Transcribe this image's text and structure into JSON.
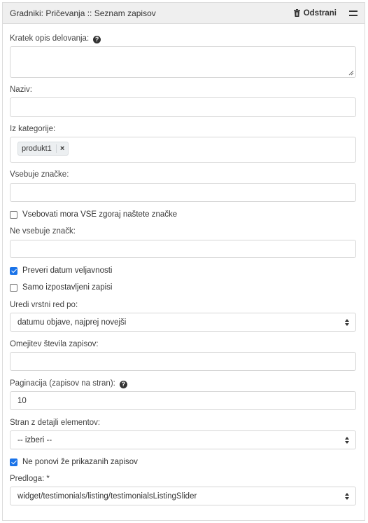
{
  "header": {
    "title": "Gradniki: Pričevanja :: Seznam zapisov",
    "remove_label": "Odstrani",
    "remove_icon": "trash-icon",
    "menu_icon": "hamburger-menu-icon"
  },
  "fields": {
    "short_description": {
      "label": "Kratek opis delovanja:",
      "value": ""
    },
    "name": {
      "label": "Naziv:",
      "value": ""
    },
    "from_category": {
      "label": "Iz kategorije:",
      "tags": [
        "produkt1"
      ],
      "remove_symbol": "×"
    },
    "contains_tags": {
      "label": "Vsebuje značke:",
      "value": ""
    },
    "must_contain_all": {
      "label": "Vsebovati mora VSE zgoraj naštete značke",
      "checked": false
    },
    "not_contains_tags": {
      "label": "Ne vsebuje značk:",
      "value": ""
    },
    "check_validity": {
      "label": "Preveri datum veljavnosti",
      "checked": true
    },
    "featured_only": {
      "label": "Samo izpostavljeni zapisi",
      "checked": false
    },
    "order_by": {
      "label": "Uredi vrstni red po:",
      "value": "datumu objave, najprej novejši"
    },
    "limit": {
      "label": "Omejitev števila zapisov:",
      "value": ""
    },
    "pagination": {
      "label": "Paginacija (zapisov na stran):",
      "value": "10"
    },
    "detail_page": {
      "label": "Stran z detajli elementov:",
      "value": "-- izberi --"
    },
    "no_repeat": {
      "label": "Ne ponovi že prikazanih zapisov",
      "checked": true
    },
    "template": {
      "label": "Predloga: *",
      "value": "widget/testimonials/listing/testimonialsListingSlider"
    }
  },
  "help_icon_glyph": "?",
  "colors": {
    "checkbox_checked": "#1a73e8",
    "header_bg": "#efefef",
    "border": "#d6d6d6"
  }
}
